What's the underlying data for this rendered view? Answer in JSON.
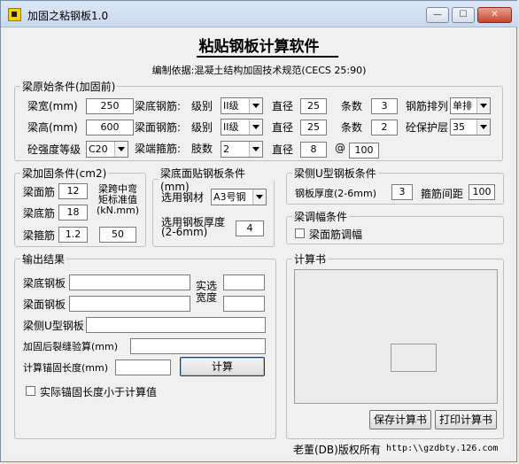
{
  "window": {
    "title": "加固之粘钢板1.0",
    "min": "—",
    "max": "☐",
    "close": "✕"
  },
  "header": {
    "title": "粘贴钢板计算软件",
    "basis": "编制依据:混凝土结构加固技术规范(CECS 25:90)"
  },
  "beam": {
    "legend": "梁原始条件(加固前)",
    "width_label": "梁宽(mm)",
    "width": "250",
    "height_label": "梁高(mm)",
    "height": "600",
    "concrete_label": "砼强度等级",
    "concrete": "C20",
    "bottom_rebar_label": "梁底钢筋:",
    "top_rebar_label": "梁面钢筋:",
    "stirrup_label": "梁端箍筋:",
    "grade_label": "级别",
    "bottom_grade": "II级",
    "top_grade": "II级",
    "legs_label": "肢数",
    "legs": "2",
    "dia_label": "直径",
    "bottom_dia": "25",
    "top_dia": "25",
    "stirrup_dia": "8",
    "count_label": "条数",
    "bottom_count": "3",
    "top_count": "2",
    "at": "@",
    "spacing": "100",
    "arrange_label": "钢筋排列",
    "arrange": "单排",
    "cover_label": "砼保护层",
    "cover": "35"
  },
  "reinf": {
    "legend": "梁加固条件(cm2)",
    "top_label": "梁面筋",
    "top": "12",
    "bottom_label": "梁底筋",
    "bottom": "18",
    "stirrup_label": "梁箍筋",
    "stirrup": "1.2",
    "moment_label": "梁跨中弯矩标准值(kN.mm)",
    "moment": "50"
  },
  "plate": {
    "legend": "梁底面贴钢板条件(mm)",
    "steel_label": "选用钢材",
    "steel": "A3号钢",
    "thick_label": "选用钢板厚度(2-6mm)",
    "thick": "4"
  },
  "uplate": {
    "legend": "梁侧U型钢板条件",
    "thick_label": "钢板厚度(2-6mm)",
    "thick": "3",
    "spacing_label": "箍筋间距",
    "spacing": "100"
  },
  "adjust": {
    "legend": "梁调幅条件",
    "check_label": "梁面筋调幅"
  },
  "output": {
    "legend": "输出结果",
    "bottom_plate_label": "梁底钢板",
    "top_plate_label": "梁面钢板",
    "width_label": "实选宽度",
    "u_plate_label": "梁侧U型钢板",
    "crack_label": "加固后裂缝验算(mm)",
    "anchor_label": "计算锚固长度(mm)",
    "calc_button": "计算",
    "check_label": "实际锚固长度小于计算值"
  },
  "report": {
    "legend": "计算书",
    "save_button": "保存计算书",
    "print_button": "打印计算书"
  },
  "footer": {
    "copyright": "老董(DB)版权所有",
    "url": "http:\\\\gzdbty.126.com"
  }
}
